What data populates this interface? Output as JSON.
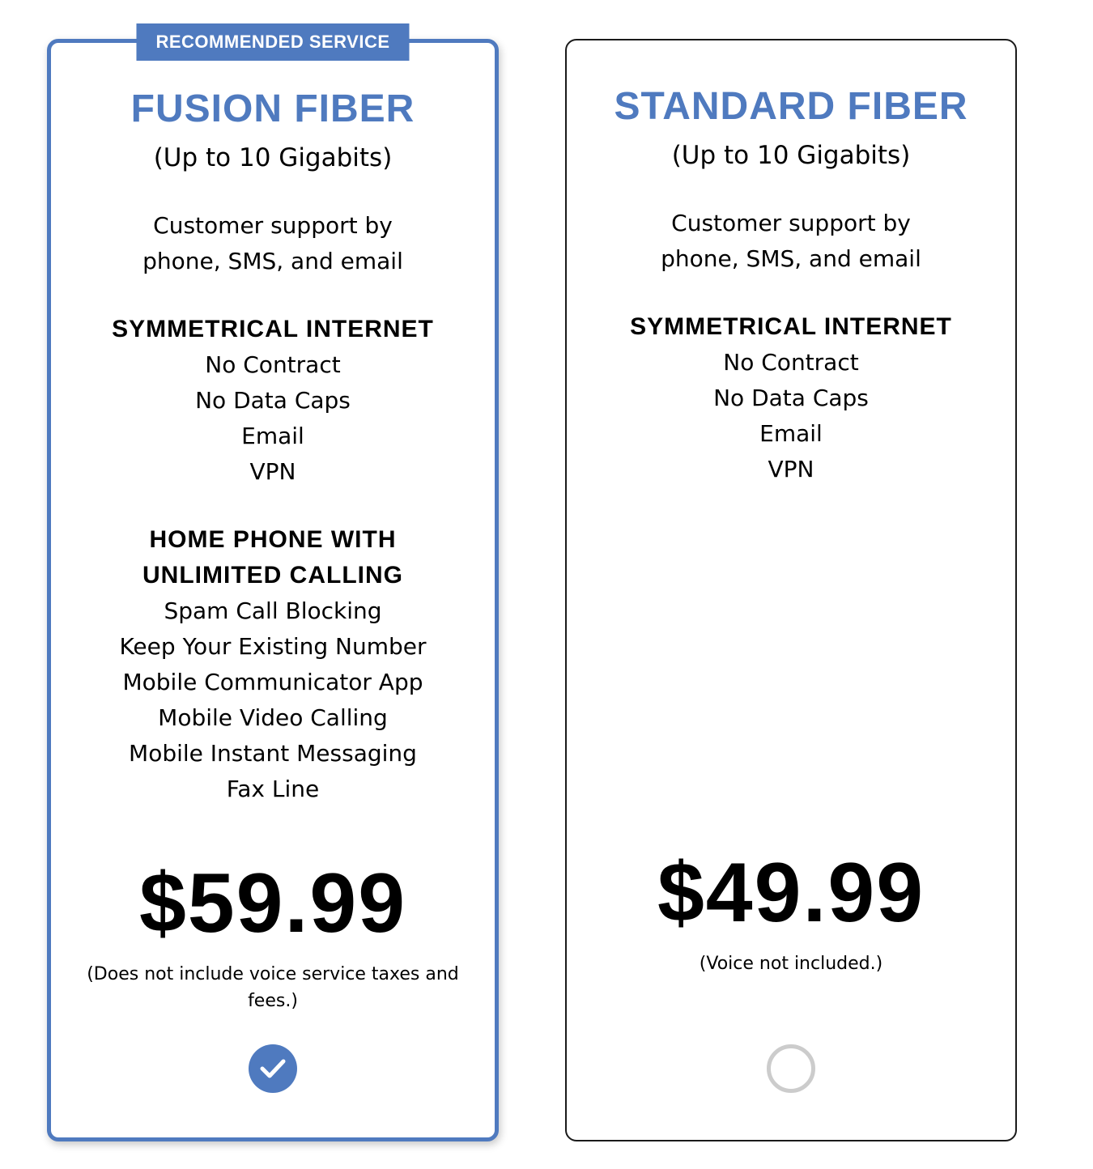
{
  "colors": {
    "accent": "#4f7abf",
    "radio_unselected": "#cccccc"
  },
  "plans": [
    {
      "badge": "RECOMMENDED SERVICE",
      "name": "FUSION FIBER",
      "speed": "(Up to 10 Gigabits)",
      "support": "Customer support by phone, SMS, and email",
      "internet_title": "SYMMETRICAL INTERNET",
      "internet_features": [
        "No Contract",
        "No Data Caps",
        "Email",
        "VPN"
      ],
      "phone_title": "HOME PHONE WITH UNLIMITED CALLING",
      "phone_features": [
        "Spam Call Blocking",
        "Keep Your Existing Number",
        "Mobile Communicator App",
        "Mobile Video Calling",
        "Mobile Instant Messaging",
        "Fax Line"
      ],
      "price": "$59.99",
      "note": "(Does not include voice service taxes and fees.)",
      "selected": true,
      "select_icon": "check-circle-icon"
    },
    {
      "name": "STANDARD FIBER",
      "speed": "(Up to 10 Gigabits)",
      "support": "Customer support by phone, SMS, and email",
      "internet_title": "SYMMETRICAL INTERNET",
      "internet_features": [
        "No Contract",
        "No Data Caps",
        "Email",
        "VPN"
      ],
      "price": "$49.99",
      "note": "(Voice not included.)",
      "selected": false,
      "select_icon": "empty-radio-icon"
    }
  ]
}
